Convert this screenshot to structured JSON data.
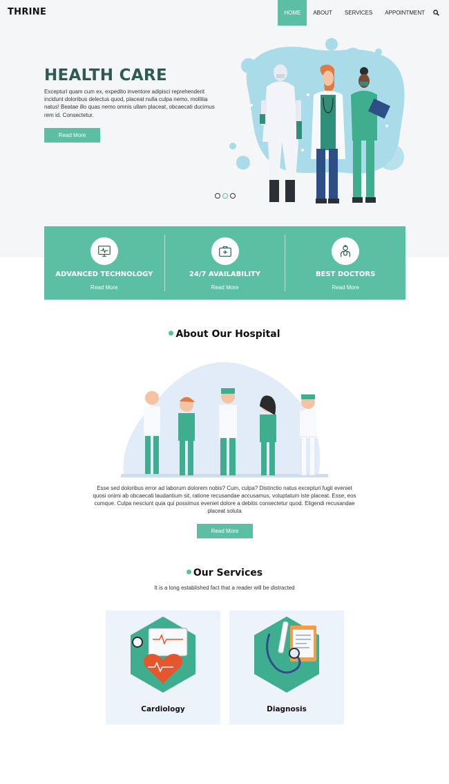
{
  "header": {
    "brand": "THRINE",
    "nav": [
      {
        "label": "HOME",
        "active": true
      },
      {
        "label": "ABOUT",
        "active": false
      },
      {
        "label": "SERVICES",
        "active": false
      },
      {
        "label": "APPOINTMENT",
        "active": false
      }
    ],
    "search_icon": "search-icon"
  },
  "hero": {
    "title": "HEALTH CARE",
    "text": "Excepturi quam cum ex, expedito inventore adipisci reprehenderit incidunt doloribus delectus quod, placeat nulla culpa nemo, mollitia natus! Beatae illo quas nemo omnis ullam placeat, obcaecati ducimus rem id. Consectetur.",
    "button": "Read More",
    "slides": 3,
    "active_slide": 2
  },
  "features": [
    {
      "title": "ADVANCED TECHNOLOGY",
      "link": "Read More",
      "icon": "monitor-icon"
    },
    {
      "title": "24/7 AVAILABILITY",
      "link": "Read More",
      "icon": "first-aid-kit-icon"
    },
    {
      "title": "BEST DOCTORS",
      "link": "Read More",
      "icon": "doctor-icon"
    }
  ],
  "about": {
    "title": "About Our Hospital",
    "text": "Esse sed doloribus error ad laborum dolorem nobis? Cum, culpa? Distinctio natus excepturi fugit eveniet quosi onimi ab obcaecati laudantium sit, ratione recusandae accusamus, voluptatum iste placeat. Esse, eos cumque. Culpa nesciunt quia qui possimus eveniet dolore a debitis consectetur quod. Eligendi recusandae placeat soluta",
    "button": "Read More"
  },
  "services": {
    "title": "Our Services",
    "subtitle": "It is a long established fact that a reader will be distracted",
    "cards": [
      {
        "label": "Cardiology",
        "icon": "heart-monitor-icon"
      },
      {
        "label": "Diagnosis",
        "icon": "stethoscope-icon"
      }
    ]
  },
  "colors": {
    "accent": "#5bbfa3",
    "title_dark": "#2e5a4f",
    "hero_bg": "#f4f6f8",
    "card_bg": "#edf3fb"
  }
}
